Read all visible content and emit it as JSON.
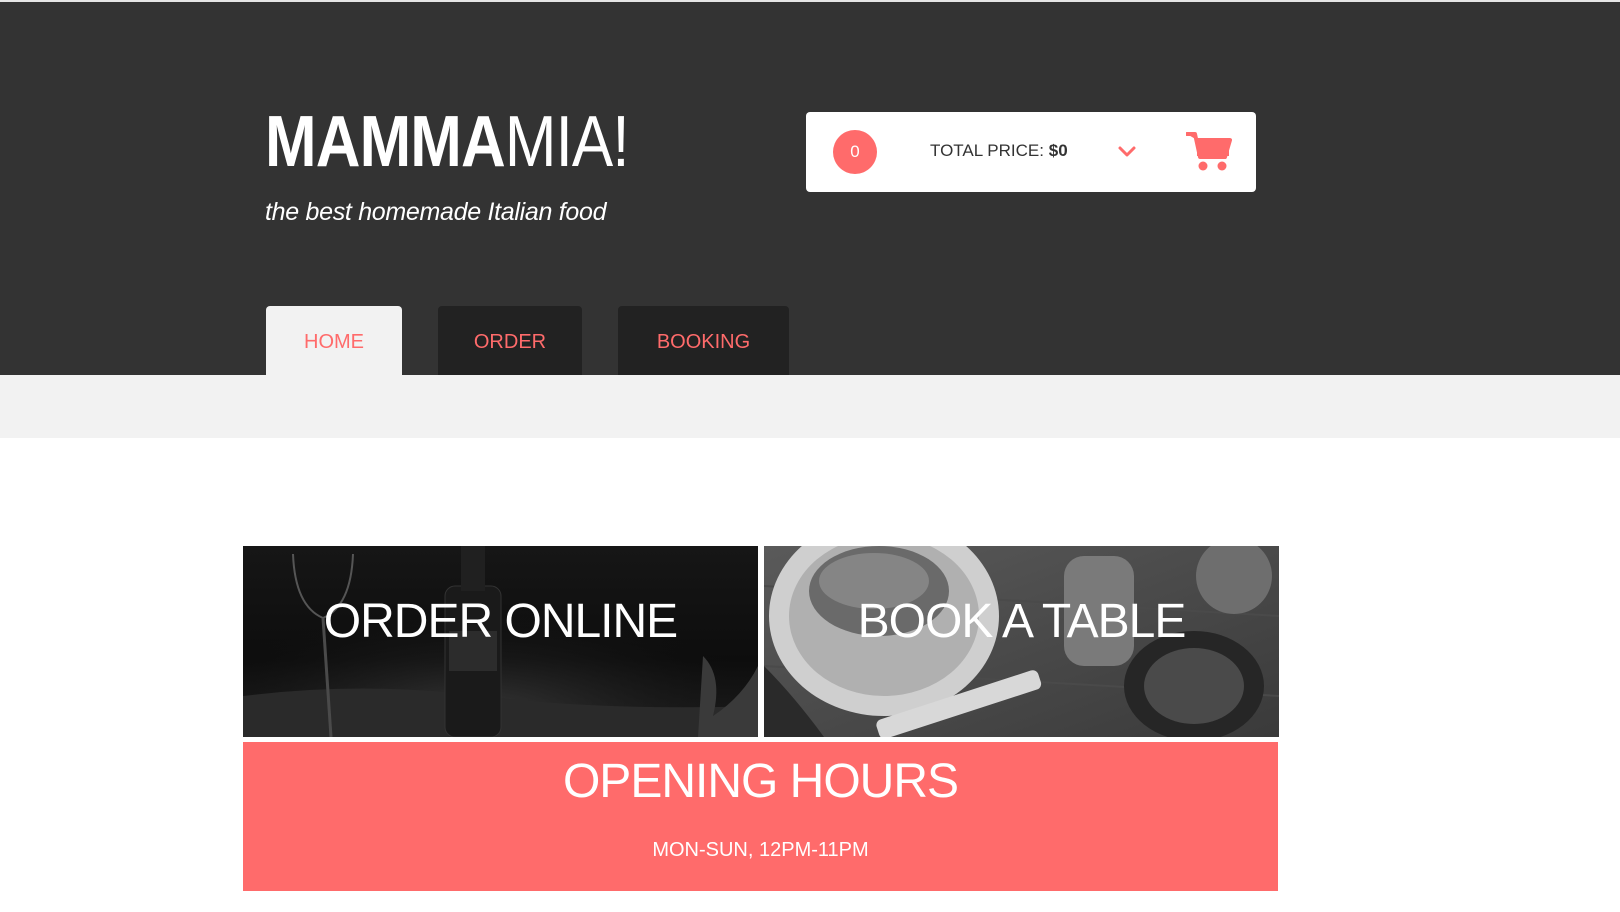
{
  "brand": {
    "logo_bold": "MAMMA",
    "logo_light": "MIA!",
    "tagline": "the best homemade Italian food"
  },
  "cart": {
    "count": "0",
    "total_label": "TOTAL PRICE:",
    "total_value": "$0",
    "icons": [
      "chevron-down-icon",
      "shopping-cart-icon"
    ],
    "accent_color": "#ff6b6b"
  },
  "nav": {
    "tabs": [
      {
        "label": "HOME",
        "active": true
      },
      {
        "label": "ORDER",
        "active": false
      },
      {
        "label": "BOOKING",
        "active": false
      }
    ]
  },
  "panels": {
    "order": {
      "label": "ORDER ONLINE"
    },
    "book": {
      "label": "BOOK A TABLE"
    }
  },
  "hours": {
    "title": "OPENING HOURS",
    "text": "MON-SUN, 12PM-11PM"
  },
  "colors": {
    "header_bg": "#333333",
    "accent": "#ff6b6b",
    "tab_inactive_bg": "#222222",
    "tab_active_bg": "#f2f2f2"
  }
}
